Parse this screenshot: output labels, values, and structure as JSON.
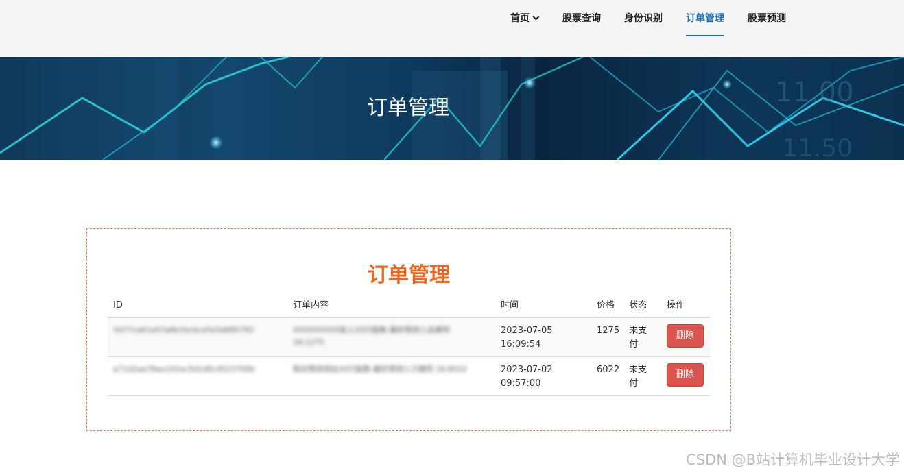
{
  "nav": {
    "items": [
      {
        "label": "首页",
        "has_dropdown": true,
        "active": false
      },
      {
        "label": "股票查询",
        "active": false
      },
      {
        "label": "身份识别",
        "active": false
      },
      {
        "label": "订单管理",
        "active": true
      },
      {
        "label": "股票预测",
        "active": false
      }
    ]
  },
  "banner": {
    "title": "订单管理"
  },
  "panel": {
    "title": "订单管理",
    "table": {
      "headers": [
        "ID",
        "订单内容",
        "时间",
        "价格",
        "状态",
        "操作"
      ],
      "rows": [
        {
          "id": "3d77ca61e07a6b1bcbce5e5d685791",
          "content": "XXXXXXXXX批入20只股数-最好预测入总摩同 16:1275",
          "date": "2023-07-05",
          "time": "16:09:54",
          "price": "1275",
          "status_line1": "未支",
          "status_line2": "付",
          "action": "删除"
        },
        {
          "id": "a71d2aa78ae101ec5d1d0c4523700b",
          "content": "购买预测测出20只股数-最好预测入只摩同 16:6022",
          "date": "2023-07-02",
          "time": "09:57:00",
          "price": "6022",
          "status_line1": "未支",
          "status_line2": "付",
          "action": "删除"
        }
      ]
    }
  },
  "watermark": "CSDN @B站计算机毕业设计大学",
  "colors": {
    "accent": "#1a6fb0",
    "title_orange": "#f0641e",
    "danger": "#d9534f"
  }
}
